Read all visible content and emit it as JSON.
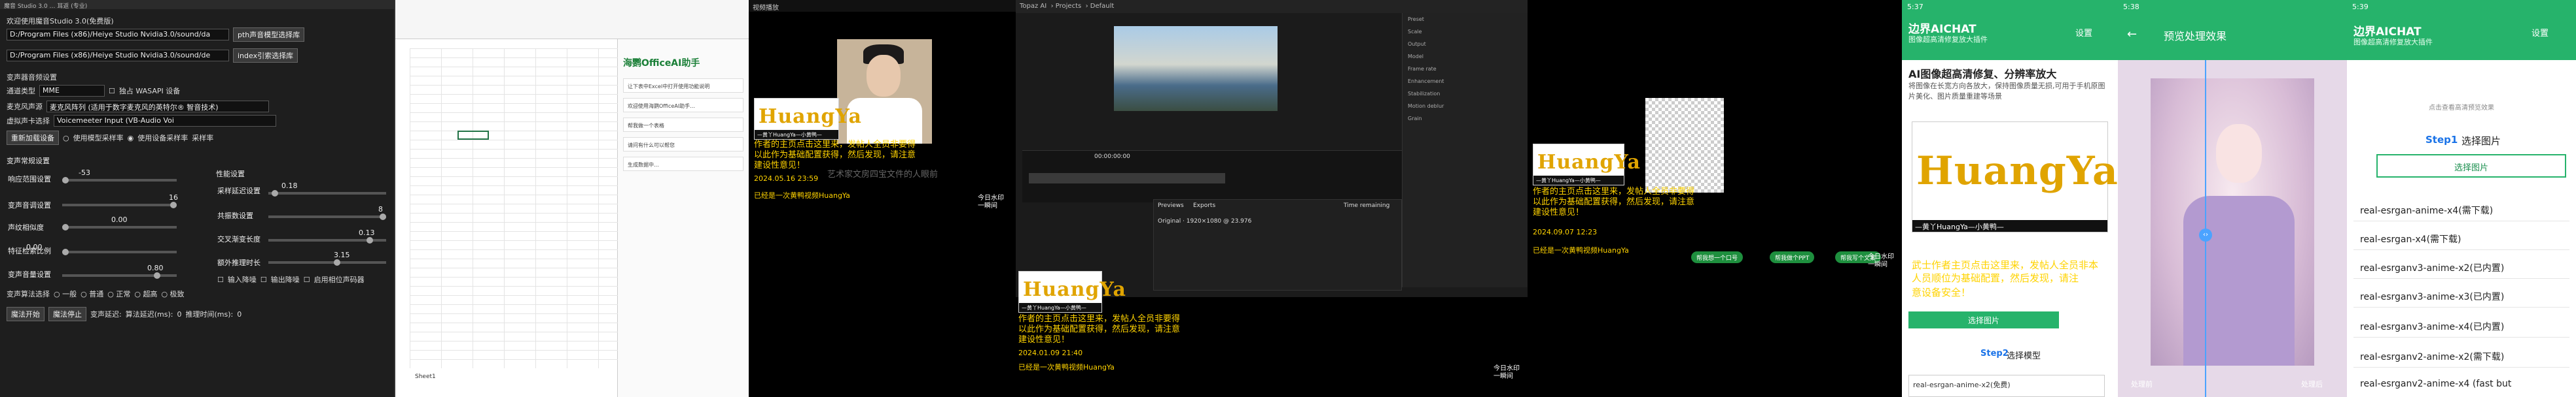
{
  "voice_app": {
    "title": "魔音 Studio 3.0 … 耳返 (专业)",
    "welcome": "欢迎使用魔音Studio 3.0(免费版)",
    "path1": "D:/Program Files (x86)/Heiye Studio Nvidia3.0/sound/da",
    "path2": "D:/Program Files (x86)/Heiye Studio Nvidia3.0/sound/de",
    "btn_open_path": "pth声音模型选择库",
    "btn_index": "index引索选择库",
    "device_section": "变声器音频设置",
    "channel_label": "通道类型",
    "channel_value": "MME",
    "wasapi": "独占 WASAPI 设备",
    "mic_label": "麦克风声源",
    "mic_value": "麦克风阵列 (适用于数字麦克风的英特尔® 智音技术)",
    "vcable_label": "虚拟声卡选择",
    "vcable_value": "Voicemeeter Input (VB-Audio Voi",
    "refresh_btn": "重新加载设备",
    "cb1": "使用模型采样率",
    "cb2": "使用设备采样率",
    "sample_rate": "采样率",
    "params_section": "变声常规设置",
    "pitch_label": "响应范围设置",
    "pitch_value": "-53",
    "volume_label": "变声音调设置",
    "volume_value": "16",
    "threshold_label": "声纹相似度",
    "threshold_value": "0.00",
    "index_label": "特征检索比例",
    "index_value": "0.00",
    "factor_label": "变声音量设置",
    "factor_value": "0.80",
    "perf_section": "性能设置",
    "p1_label": "采样延迟设置",
    "p1_value": "0.18",
    "p2_label": "共振数设置",
    "p2_value": "8",
    "p3_label": "交叉渐变长度",
    "p3_value": "0.13",
    "p4_label": "额外推理时长",
    "p4_value": "3.15",
    "mode_label": "变声算法选择",
    "modes": [
      "一般",
      "普通",
      "正常",
      "超高",
      "极致"
    ],
    "input_denoise": "输入降噪",
    "output_denoise": "输出降噪",
    "phase_vocoder": "启用相位声码器",
    "start_btn": "魔法开始",
    "stop_btn": "魔法停止",
    "delay_text": "变声延迟:",
    "algo_delay": "算法延迟(ms):",
    "algo_delay_val": "0",
    "infer_time": "推理时间(ms):",
    "infer_time_val": "0"
  },
  "sheet_app": {
    "assistant_title": "海鹦OfficeAI助手",
    "messages": [
      "让下表中Excel中打开使用功能说明",
      "欢迎使用海鹦OfficeAI助手…",
      "帮我做一个表格",
      "请问有什么可以帮您",
      "生成数据中…"
    ],
    "sheet_tab": "Sheet1"
  },
  "video1": {
    "title": "视频播放",
    "logo_word": "HuangYa",
    "logo_bar": "—黄丫HuangYa—小黄鸭—",
    "overlay_lines": [
      "作者的主页点击这里来，发帖人全员非要得",
      "以此作为基础配置获得，然后发现，请注意",
      "建设性意见！"
    ],
    "chip1": "2024.05.16 23:59",
    "chip2": "已经是一次黄鸭视频HuangYa",
    "caption_w": "艺术家文房四宝文件的人眼前",
    "corner_title": "今日水印",
    "corner_sub": "一瞬间"
  },
  "editor": {
    "app": "Topaz AI",
    "crumbs": [
      "Projects",
      "Default"
    ],
    "props": [
      "Preset",
      "Scale",
      "Output",
      "Model",
      "Frame rate",
      "Enhancement",
      "Stabilization",
      "Motion deblur",
      "Grain"
    ],
    "timeline_time": "00:00:00:00",
    "tabs": [
      "Previews",
      "Exports"
    ],
    "time_remaining": "Time remaining",
    "export_label": "Original · 1920×1080 @ 23.976",
    "logo_word": "HuangYa",
    "logo_bar": "—黄丫HuangYa—小黄鸭—",
    "overlay_lines": [
      "作者的主页点击这里来，发帖人全员非要得",
      "以此作为基础配置获得，然后发现，请注意",
      "建设性意见！"
    ],
    "chip1": "2024.01.09 21:40",
    "chip2": "已经是一次黄鸭视频HuangYa",
    "corner_title": "今日水印",
    "corner_sub": "一瞬间"
  },
  "video2": {
    "logo_word": "HuangYa",
    "logo_bar": "—黄丫HuangYa—小黄鸭—",
    "overlay_lines": [
      "作者的主页点击这里来，发帖人全员非要得",
      "以此作为基础配置获得，然后发现，请注意",
      "建设性意见！"
    ],
    "chip1": "2024.09.07 12:23",
    "chip2": "已经是一次黄鸭视频HuangYa",
    "pills": [
      "帮我想一个口号",
      "帮我做个PPT",
      "帮我写个文案"
    ],
    "corner_title": "今日水印",
    "corner_sub": "一瞬间"
  },
  "phone1": {
    "time": "5:37",
    "title": "边界AICHAT",
    "subtitle": "图像超高清修复放大插件",
    "settings": "设置",
    "headline": "AI图像超高清修复、分辨率放大",
    "desc": "将图像在长宽方向各放大，保持图像质量无损,可用于手机原图片美化、图片质量重建等场景",
    "logo_word": "HuangYa",
    "logo_bar": "—黄丫HuangYa—小黄鸭—",
    "overlay_lines": [
      "武士作者主页点击这里来，发帖人全员非本",
      "人员顺位为基础配置，然后发现，请注",
      "意设备安全！"
    ],
    "pick_btn": "选择图片",
    "step2": "Step2",
    "select_model": "选择模型",
    "dropdown": "real-esrgan-anime-x2(免费)"
  },
  "phone2": {
    "time": "5:38",
    "back": "←",
    "title": "预览处理效果",
    "left_label": "处理前",
    "right_label": "处理后"
  },
  "phone3": {
    "time": "5:39",
    "title": "边界AICHAT",
    "subtitle": "图像超高清修复放大插件",
    "settings": "设置",
    "hint": "点击查看高清预览效果",
    "step1": "Step1",
    "select_image": "选择图片",
    "pick_btn": "选择图片",
    "models": [
      "real-esrgan-anime-x4(需下载)",
      "real-esrgan-x4(需下载)",
      "real-esrganv3-anime-x2(已内置)",
      "real-esrganv3-anime-x3(已内置)",
      "real-esrganv3-anime-x4(已内置)",
      "real-esrganv2-anime-x2(需下载)",
      "real-esrganv2-anime-x4 (fast but"
    ]
  }
}
